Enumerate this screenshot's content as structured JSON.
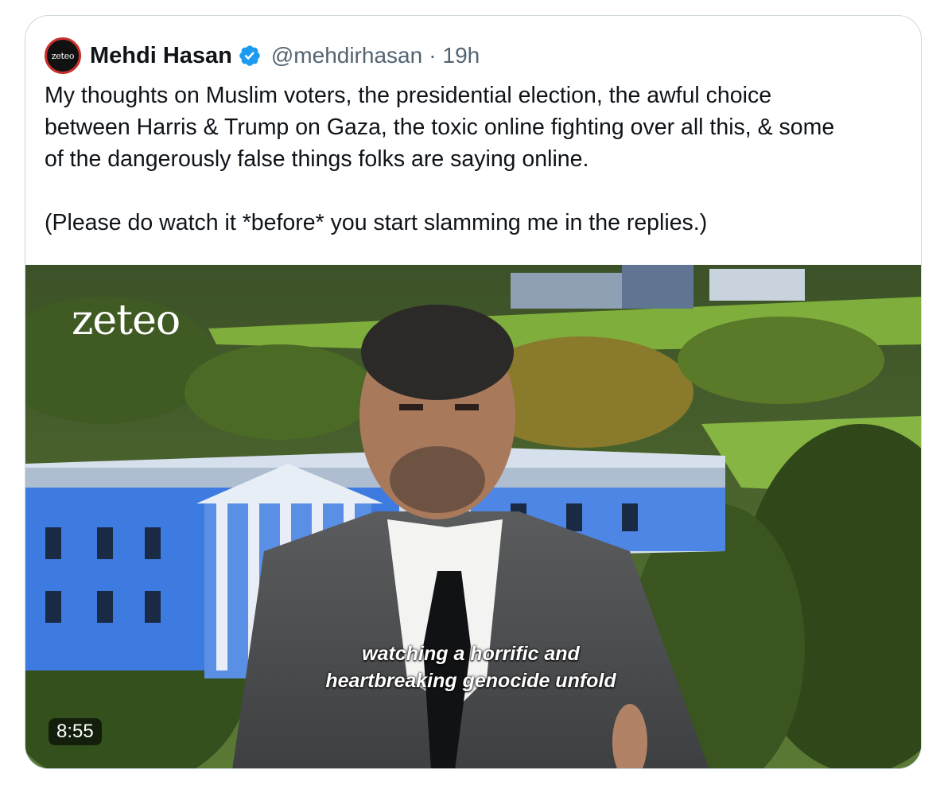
{
  "author": {
    "avatar_text": "zeteo",
    "name": "Mehdi Hasan",
    "verified_icon": "verified-badge-icon",
    "handle": "@mehdirhasan",
    "separator": "·",
    "time": "19h"
  },
  "tweet": {
    "text": "My thoughts on Muslim voters, the presidential election, the awful choice\nbetween Harris & Trump on Gaza, the toxic online fighting over all this, & some\nof the dangerously false things folks are saying online.\n\n(Please do watch it *before* you start slamming me in the replies.)"
  },
  "video": {
    "brand_logo": "zeteo",
    "caption_line1": "watching a horrific and",
    "caption_line2": "heartbreaking genocide unfold",
    "duration": "8:55"
  },
  "colors": {
    "verified": "#1d9bf0",
    "secondary_text": "#536471",
    "border": "#cfd9de"
  }
}
